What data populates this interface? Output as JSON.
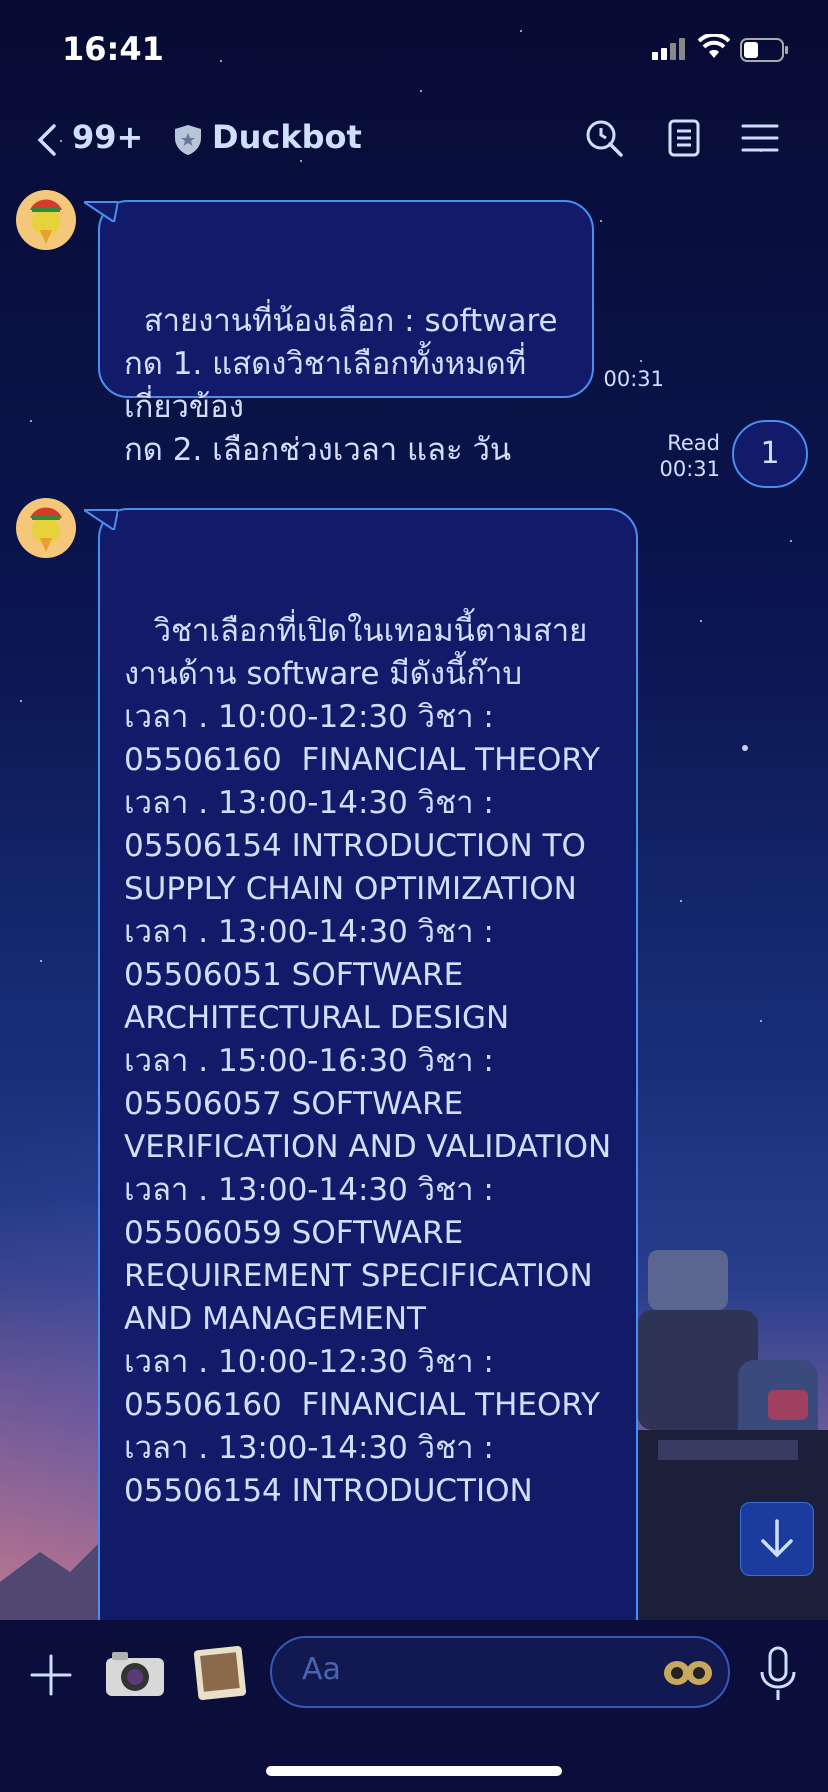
{
  "status_bar": {
    "time": "16:41"
  },
  "nav": {
    "unread_count": "99+",
    "chat_title": "Duckbot"
  },
  "messages": {
    "m1": {
      "text": "สายงานที่น้องเลือก : software\nกด 1. แสดงวิชาเลือกทั้งหมดที่เกี่ยวข้อง\nกด 2. เลือกช่วงเวลา และ วัน",
      "time": "00:31"
    },
    "m2": {
      "text": "1",
      "read_label": "Read",
      "time": "00:31"
    },
    "m3": {
      "text": " วิชาเลือกที่เปิดในเทอมนี้ตามสายงานด้าน software มีดังนี้ก๊าบ\nเวลา . 10:00-12:30 วิชา : 05506160  FINANCIAL THEORY\nเวลา . 13:00-14:30 วิชา : 05506154 INTRODUCTION TO SUPPLY CHAIN OPTIMIZATION\nเวลา . 13:00-14:30 วิชา : 05506051 SOFTWARE ARCHITECTURAL DESIGN\nเวลา . 15:00-16:30 วิชา : 05506057 SOFTWARE VERIFICATION AND VALIDATION\nเวลา . 13:00-14:30 วิชา : 05506059 SOFTWARE REQUIREMENT SPECIFICATION AND MANAGEMENT\nเวลา . 10:00-12:30 วิชา : 05506160  FINANCIAL THEORY\nเวลา . 13:00-14:30 วิชา : 05506154 INTRODUCTION"
    }
  },
  "composer": {
    "placeholder": "Aa"
  },
  "icons": {
    "back": "chevron-left-icon",
    "verified": "shield-icon",
    "search": "clock-search-icon",
    "notes": "notes-icon",
    "menu": "hamburger-menu-icon",
    "plus": "plus-icon",
    "camera": "camera-icon",
    "photo": "photo-icon",
    "emoji": "sticker-icon",
    "mic": "microphone-icon",
    "scroll": "arrow-down-icon"
  },
  "colors": {
    "bubble_bg": "#121a6a",
    "bubble_border": "#4a8ef0",
    "text": "#cfe0ff"
  }
}
